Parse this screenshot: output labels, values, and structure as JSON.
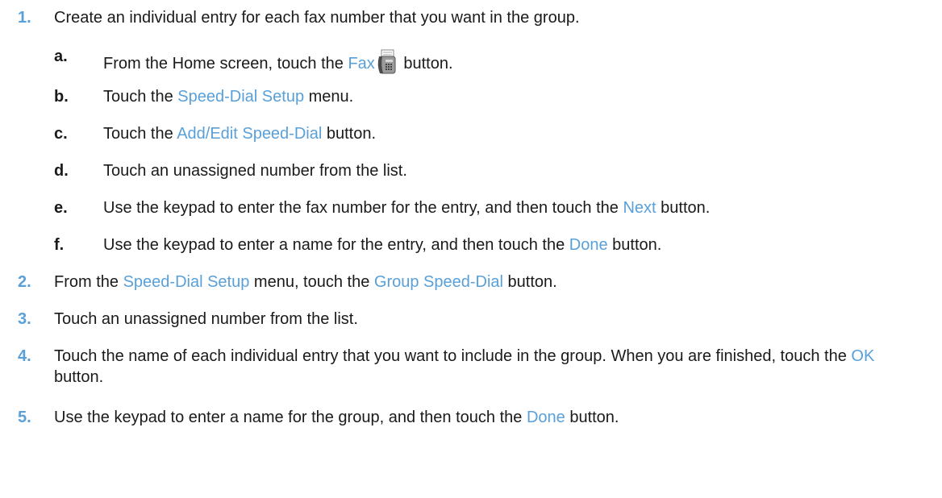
{
  "steps": [
    {
      "num": "1.",
      "text": "Create an individual entry for each fax number that you want in the group.",
      "substeps": [
        {
          "letter": "a.",
          "pre": "From the Home screen, touch the ",
          "link": "Fax",
          "icon": "fax-icon",
          "post": " button."
        },
        {
          "letter": "b.",
          "pre": "Touch the ",
          "link": "Speed-Dial Setup",
          "post": " menu."
        },
        {
          "letter": "c.",
          "pre": "Touch the ",
          "link": "Add/Edit Speed-Dial",
          "post": " button."
        },
        {
          "letter": "d.",
          "pre": "Touch an unassigned number from the list.",
          "link": "",
          "post": ""
        },
        {
          "letter": "e.",
          "pre": "Use the keypad to enter the fax number for the entry, and then touch the ",
          "link": "Next",
          "post": " button."
        },
        {
          "letter": "f.",
          "pre": "Use the keypad to enter a name for the entry, and then touch the ",
          "link": "Done",
          "post": " button."
        }
      ]
    },
    {
      "num": "2.",
      "pre": "From the ",
      "link1": "Speed-Dial Setup",
      "mid": " menu, touch the ",
      "link2": "Group Speed-Dial",
      "post": " button."
    },
    {
      "num": "3.",
      "text": "Touch an unassigned number from the list."
    },
    {
      "num": "4.",
      "pre": "Touch the name of each individual entry that you want to include in the group. When you are finished, touch the ",
      "link": "OK",
      "post": " button."
    },
    {
      "num": "5.",
      "pre": "Use the keypad to enter a name for the group, and then touch the ",
      "link": "Done",
      "post": " button."
    }
  ],
  "colors": {
    "accent": "#5aa0d8",
    "text": "#1a1a1a"
  }
}
